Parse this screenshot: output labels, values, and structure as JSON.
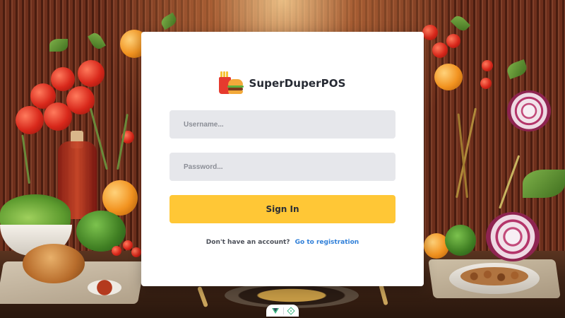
{
  "app": {
    "brand_name": "SuperDuperPOS",
    "logo_icon": "fries-burger-logo"
  },
  "login": {
    "username_placeholder": "Username...",
    "username_value": "",
    "password_placeholder": "Password...",
    "password_value": "",
    "sign_in_label": "Sign In",
    "register_prompt": "Don't have an account?",
    "register_link": "Go to registration"
  },
  "devtools": {
    "icons": [
      "vue-logo-icon",
      "inspector-target-icon"
    ]
  },
  "colors": {
    "accent": "#ffc736",
    "link": "#2f7fd8",
    "input_bg": "#e6e7eb",
    "card_bg": "#ffffff"
  }
}
